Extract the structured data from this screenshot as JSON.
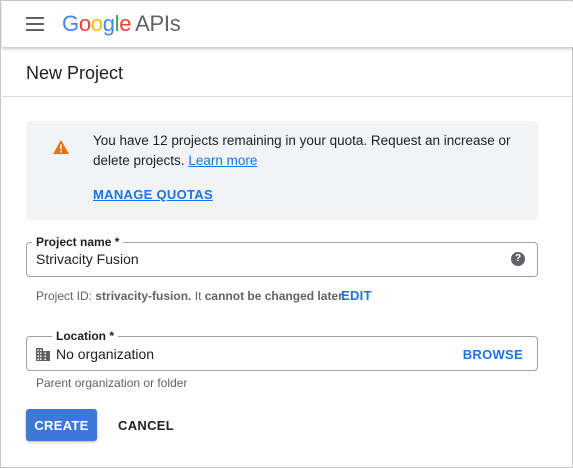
{
  "topbar": {
    "menu_icon": "hamburger-menu-icon",
    "logo": {
      "g1": "G",
      "o1": "o",
      "o2": "o",
      "g2": "g",
      "l": "l",
      "e": "e",
      "suffix": "APIs"
    }
  },
  "header": {
    "title": "New Project"
  },
  "notice": {
    "icon": "warning-icon",
    "icon_color": "#e8710a",
    "text": "You have 12 projects remaining in your quota. Request an increase or delete projects.",
    "learn_more": "Learn more",
    "manage_quotas": "MANAGE QUOTAS"
  },
  "project_name": {
    "label": "Project name *",
    "value": "Strivacity Fusion",
    "help_icon": "help-circle-icon",
    "help_glyph": "?"
  },
  "project_id": {
    "prefix": "Project ID:",
    "id": "strivacity-fusion.",
    "middle": "It",
    "suffix": "cannot be changed later.",
    "edit_label": "EDIT"
  },
  "location": {
    "label": "Location *",
    "icon": "building-icon",
    "value": "No organization",
    "browse_label": "BROWSE",
    "hint": "Parent organization or folder"
  },
  "actions": {
    "create_label": "CREATE",
    "cancel_label": "CANCEL"
  },
  "colors": {
    "accent": "#1a73e8",
    "primary_button": "#3c78d8",
    "notice_bg": "#f1f3f4"
  }
}
